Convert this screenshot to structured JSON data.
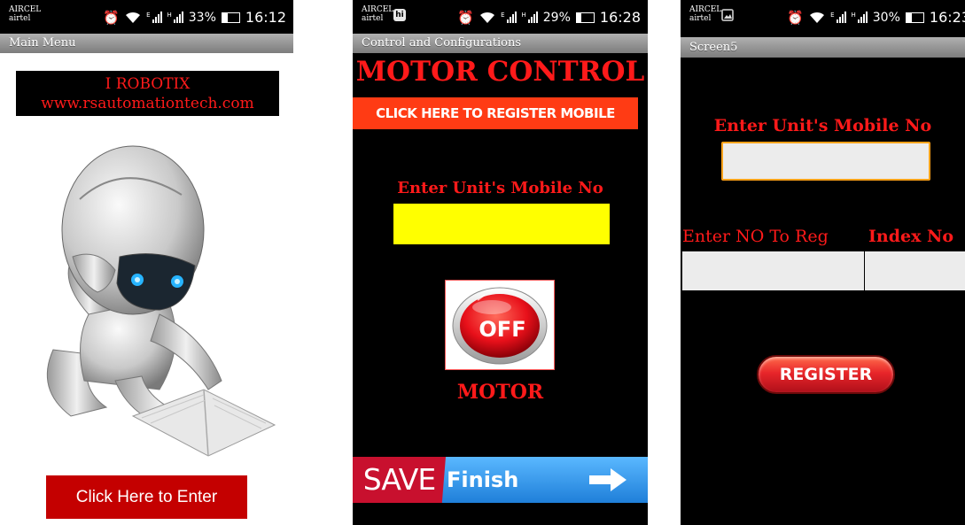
{
  "colors": {
    "red_text": "#ff1a1a",
    "yellow_input": "#ffff00",
    "title_grey": "#8c8c8c",
    "enter_red": "#c40000"
  },
  "screens": [
    {
      "status": {
        "carrier_line1": "AIRCEL",
        "carrier_line2": "airtel",
        "sig1_label": "E",
        "sig2_label": "H",
        "battery": "33%",
        "battery_level": 0.33,
        "time": "16:12"
      },
      "title": "Main Menu",
      "banner": {
        "line1": "I ROBOTIX",
        "line2": "www.rsautomationtech.com"
      },
      "image_icon": "robot-reading-book-image",
      "enter_button": "Click Here to Enter"
    },
    {
      "status": {
        "carrier_line1": "AIRCEL",
        "carrier_line2": "airtel",
        "notif_icon": "hike-icon",
        "notif_glyph": "hi",
        "sig1_label": "E",
        "sig2_label": "H",
        "battery": "29%",
        "battery_level": 0.29,
        "time": "16:28"
      },
      "title": "Control and Configurations",
      "heading": "MOTOR CONTROL",
      "register_button": "CLICK HERE TO REGISTER MOBILE",
      "mobile_label": "Enter Unit's Mobile No",
      "mobile_value": "",
      "toggle_icon": "power-off-button-icon",
      "toggle_text": "OFF",
      "motor_label": "MOTOR",
      "save_tag": "SAVE",
      "finish_label": "Finish",
      "arrow_icon": "right-arrow-icon"
    },
    {
      "status": {
        "carrier_line1": "AIRCEL",
        "carrier_line2": "airtel",
        "notif_icon": "gallery-icon",
        "sig1_label": "E",
        "sig2_label": "H",
        "battery": "30%",
        "battery_level": 0.3,
        "time": "16:23"
      },
      "title": "Screen5",
      "mobile_label": "Enter Unit's Mobile No",
      "mobile_value": "",
      "reg_label": "Enter NO To Reg",
      "index_label": "Index No",
      "reg_value": "",
      "index_value": "",
      "register_button": "REGISTER"
    }
  ]
}
